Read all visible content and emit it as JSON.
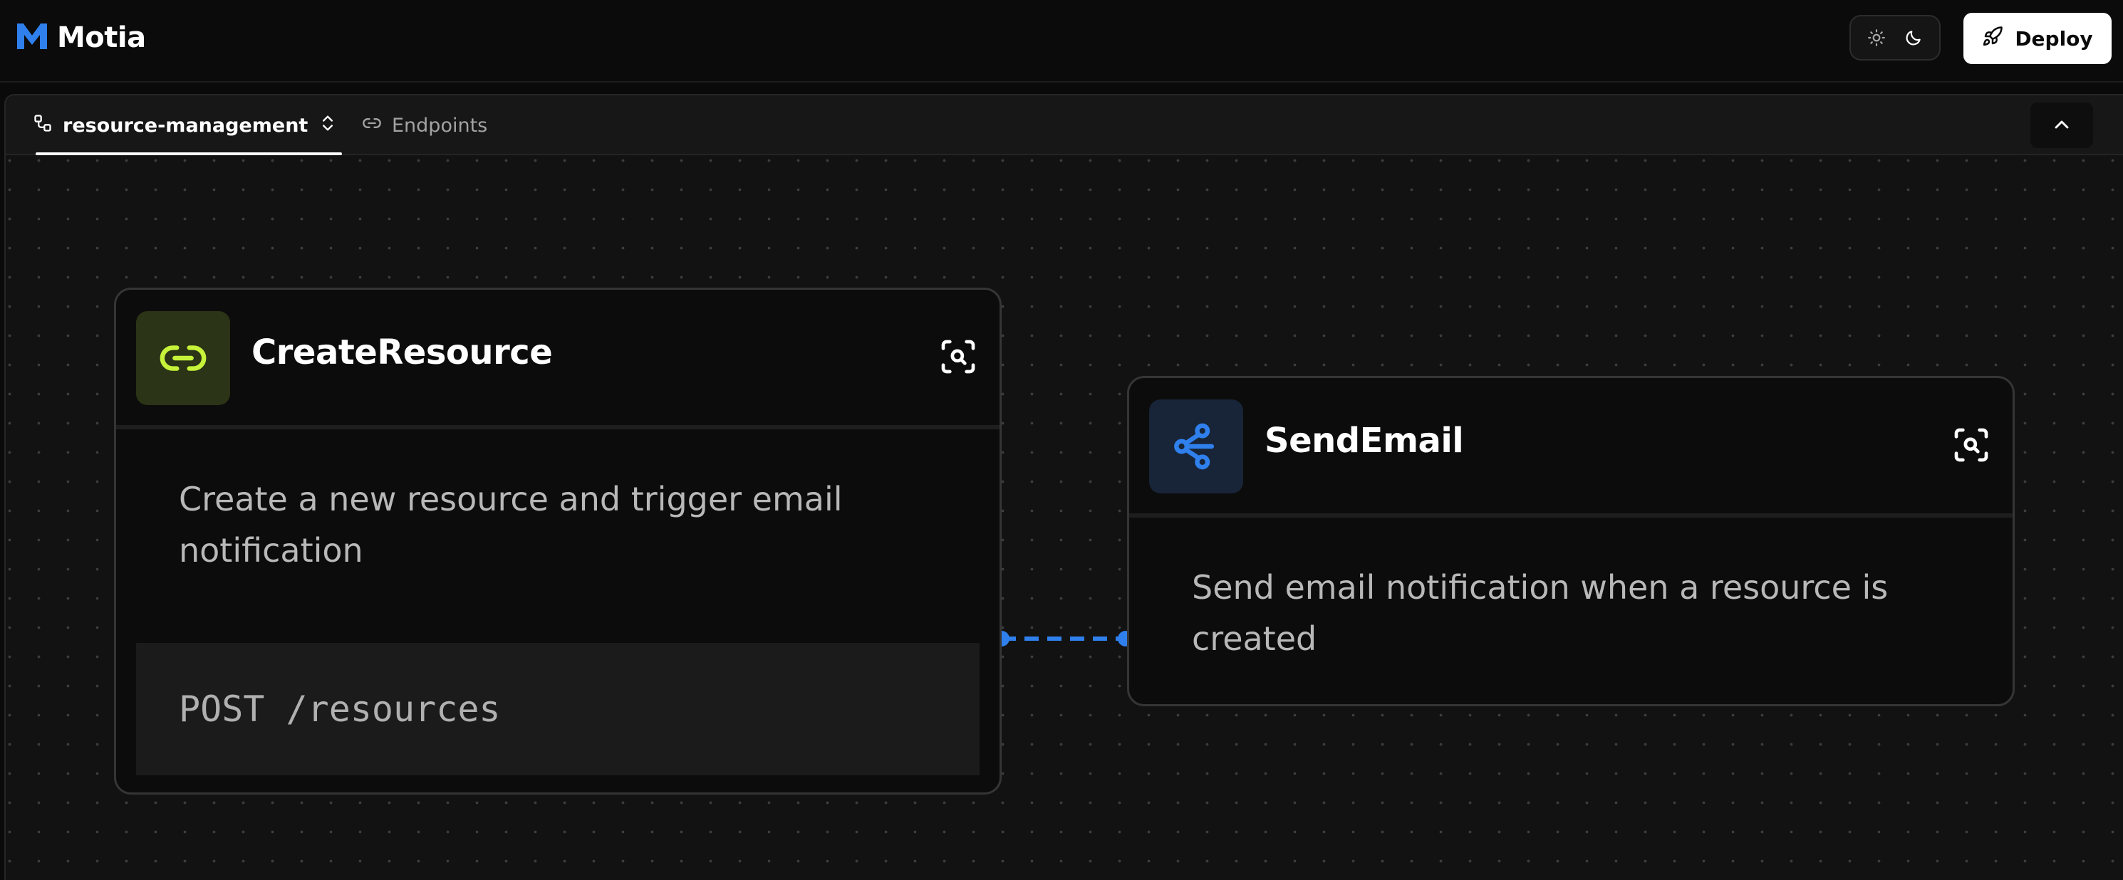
{
  "app": {
    "name": "Motia",
    "brand_color": "#2f80ed"
  },
  "header": {
    "theme_toggle": {
      "options": [
        "light",
        "dark"
      ],
      "selected": "dark"
    },
    "deploy_label": "Deploy"
  },
  "tabs": [
    {
      "label": "resource-management",
      "active": true,
      "has_selector": true
    },
    {
      "label": "Endpoints",
      "active": false
    }
  ],
  "flow": {
    "nodes": [
      {
        "title": "CreateResource",
        "type": "api",
        "icon": "link-icon",
        "icon_color": "#c6f33a",
        "icon_bg": "#2b3416",
        "description": "Create a new resource and trigger email notification",
        "endpoint": "POST /resources"
      },
      {
        "title": "SendEmail",
        "type": "event",
        "icon": "workflow-icon",
        "icon_color": "#2f80ed",
        "icon_bg": "#182438",
        "description": "Send email notification when a resource is created"
      }
    ],
    "edges": [
      {
        "from": "CreateResource",
        "to": "SendEmail",
        "style": "dashed",
        "color": "#2f80ed"
      }
    ]
  }
}
